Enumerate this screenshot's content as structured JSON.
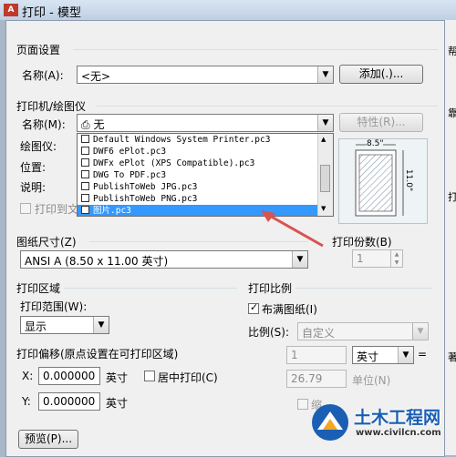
{
  "window": {
    "title": "打印 - 模型",
    "app_icon": "A"
  },
  "right_strip": [
    "帮",
    "靠",
    "打",
    "著"
  ],
  "page_setup": {
    "group": "页面设置",
    "name_label": "名称(A):",
    "name_value": "<无>",
    "add_button": "添加(.)..."
  },
  "printer": {
    "group": "打印机/绘图仪",
    "name_label": "名称(M):",
    "name_value": "无",
    "properties_button": "特性(R)...",
    "plotter_label": "绘图仪:",
    "location_label": "位置:",
    "description_label": "说明:",
    "print_to_file_label": "打印到文",
    "dropdown_items": [
      "Default Windows System Printer.pc3",
      "DWF6 ePlot.pc3",
      "DWFx ePlot (XPS Compatible).pc3",
      "DWG To PDF.pc3",
      "PublishToWeb JPG.pc3",
      "PublishToWeb PNG.pc3",
      "图片.pc3"
    ],
    "selected_index": 6,
    "preview_width": "8.5\"",
    "preview_height": "11.0\""
  },
  "paper_size": {
    "group": "图纸尺寸(Z)",
    "value": "ANSI A (8.50 x 11.00 英寸)"
  },
  "copies": {
    "label": "打印份数(B)",
    "value": "1"
  },
  "plot_area": {
    "group": "打印区域",
    "range_label": "打印范围(W):",
    "range_value": "显示"
  },
  "plot_scale": {
    "group": "打印比例",
    "fit_label": "布满图纸(I)",
    "fit_checked": true,
    "scale_label": "比例(S):",
    "scale_value": "自定义",
    "value1": "1",
    "unit": "英寸",
    "equals": "=",
    "value2": "26.79",
    "unit_label": "单位(N)",
    "lineweights_label": "缩"
  },
  "plot_offset": {
    "group": "打印偏移(原点设置在可打印区域)",
    "x_label": "X:",
    "x_value": "0.000000",
    "x_unit": "英寸",
    "center_label": "居中打印(C)",
    "y_label": "Y:",
    "y_value": "0.000000",
    "y_unit": "英寸"
  },
  "footer": {
    "preview_button": "预览(P)..."
  },
  "watermark": {
    "name": "土木工程网",
    "url": "www.civilcn.com"
  },
  "colors": {
    "highlight": "#3399ff",
    "arrow": "#d9534f",
    "watermark_blue": "#1a5fb4"
  }
}
